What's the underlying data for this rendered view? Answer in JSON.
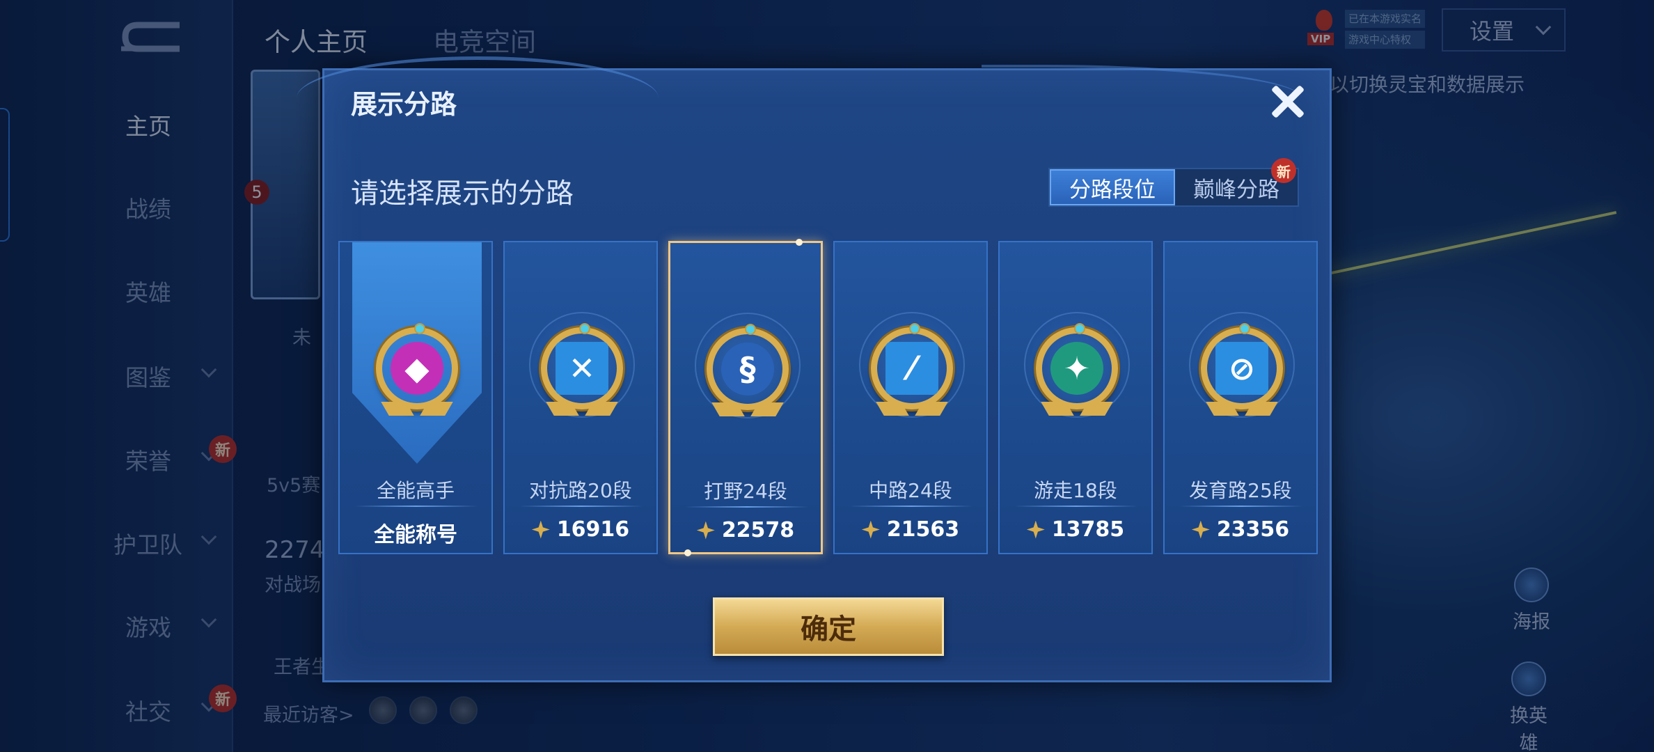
{
  "sidebar": {
    "items": [
      {
        "label": "主页"
      },
      {
        "label": "战绩"
      },
      {
        "label": "英雄"
      },
      {
        "label": "图鉴"
      },
      {
        "label": "荣誉"
      },
      {
        "label": "护卫队"
      },
      {
        "label": "游戏"
      },
      {
        "label": "社交"
      }
    ],
    "new_badge": "新"
  },
  "top_tabs": [
    "个人主页",
    "电竞空间"
  ],
  "header": {
    "settings_label": "设置",
    "vip_tag": "VIP",
    "vip_line1": "已在本游戏实名",
    "vip_line2": "游戏中心特权",
    "hint": "以切换灵宝和数据展示"
  },
  "background": {
    "hero_level": "5",
    "status_text": "未",
    "mode_label": "5v5赛",
    "stat_value": "2274",
    "stat_label": "对战场",
    "honor_label": "王者生",
    "recent_visitors": "最近访客>",
    "poster_label": "海报",
    "change_hero_label": "换英雄"
  },
  "modal": {
    "title": "展示分路",
    "subtitle": "请选择展示的分路",
    "segments": [
      {
        "label": "分路段位",
        "active": true
      },
      {
        "label": "巅峰分路",
        "active": false,
        "badge": "新"
      }
    ],
    "lanes": [
      {
        "name": "全能高手",
        "value": "全能称号",
        "icon": "all-round-master-icon",
        "inner_color": "#c42fb8",
        "selected": false
      },
      {
        "name": "对抗路20段",
        "value": "16916",
        "icon": "clash-lane-icon",
        "inner_color": "#2b8ee0",
        "selected": false
      },
      {
        "name": "打野24段",
        "value": "22578",
        "icon": "jungle-dragon-icon",
        "inner_color": "#2a62b8",
        "selected": true
      },
      {
        "name": "中路24段",
        "value": "21563",
        "icon": "mid-lane-icon",
        "inner_color": "#2b8ee0",
        "selected": false
      },
      {
        "name": "游走18段",
        "value": "13785",
        "icon": "roam-wings-icon",
        "inner_color": "#1f9a7e",
        "selected": false
      },
      {
        "name": "发育路25段",
        "value": "23356",
        "icon": "farm-lane-icon",
        "inner_color": "#2b8ee0",
        "selected": false
      }
    ],
    "confirm_label": "确定"
  },
  "colors": {
    "accent_gold": "#d9ae4e",
    "accent_blue": "#2a63b8",
    "selected_border": "#f0c785"
  }
}
